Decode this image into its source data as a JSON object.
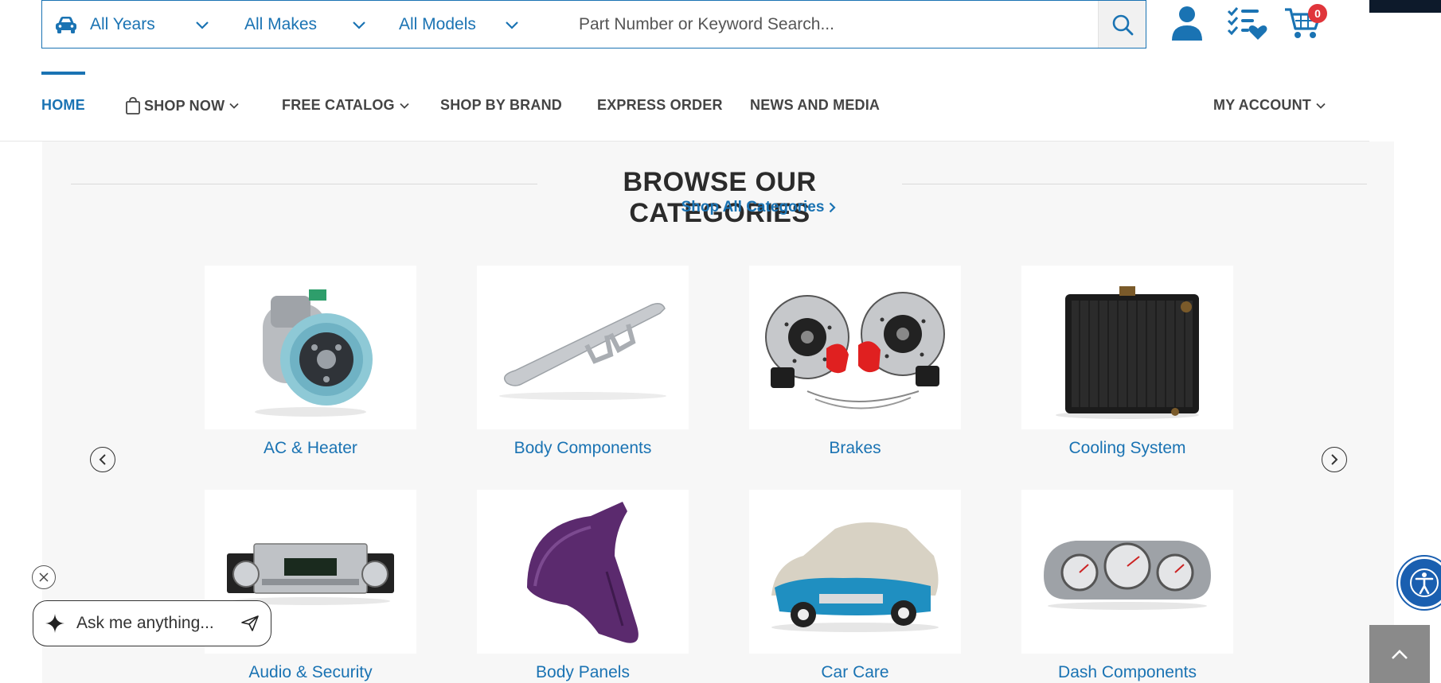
{
  "vehicle_selector": {
    "years": "All Years",
    "makes": "All Makes",
    "models": "All Models"
  },
  "search": {
    "placeholder": "Part Number or Keyword Search..."
  },
  "header_icons": {
    "account": "account-icon",
    "wishlist": "wishlist-icon",
    "cart": "cart-icon",
    "cart_count": "0"
  },
  "nav": {
    "home": "HOME",
    "shop_now": "SHOP NOW",
    "free_catalog": "FREE CATALOG",
    "shop_by_brand": "SHOP BY BRAND",
    "express_order": "EXPRESS ORDER",
    "news_and_media": "NEWS AND MEDIA",
    "my_account": "MY ACCOUNT"
  },
  "categories_section": {
    "title": "BROWSE OUR CATEGORIES",
    "shop_all": "Shop All Categories",
    "row1": [
      "AC & Heater",
      "Body Components",
      "Brakes",
      "Cooling System"
    ],
    "row2": [
      "Audio & Security",
      "Body Panels",
      "Car Care",
      "Dash Components"
    ]
  },
  "chat": {
    "prompt": "Ask me anything..."
  },
  "colors": {
    "accent": "#1a73b3",
    "badge": "#e0353b",
    "panel_bg": "#f7f7f7",
    "brake_caliper": "#e02020",
    "body_panel": "#5b2a6e",
    "car_body": "#1f8fc1"
  }
}
